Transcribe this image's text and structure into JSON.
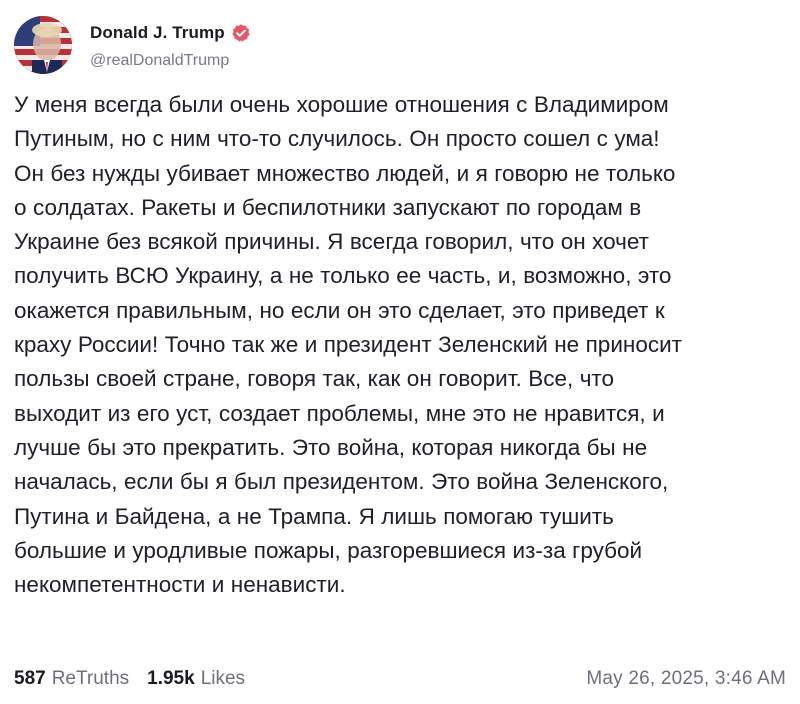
{
  "post": {
    "author": {
      "display_name": "Donald J. Trump",
      "handle": "@realDonaldTrump",
      "verified": true,
      "avatar": "avatar",
      "badge_icon": "verified-badge-icon",
      "badge_color": "#e5556a"
    },
    "body_lines": [
      "У меня всегда были очень хорошие отношения с Владимиром",
      "Путиным, но с ним что-то случилось. Он просто сошел с ума!",
      "Он без нужды убивает множество людей, и я говорю не только",
      "о солдатах. Ракеты и беспилотники запускают по городам в",
      "Украине без всякой причины. Я всегда говорил, что он хочет",
      "получить ВСЮ Украину, а не только ее часть, и, возможно, это",
      "окажется правильным, но если он это сделает, это приведет к",
      "краху России! Точно так же и президент Зеленский не приносит",
      "пользы своей стране, говоря так, как он говорит. Все, что",
      "выходит из его уст, создает проблемы, мне это не нравится, и",
      "лучше бы это прекратить. Это война, которая никогда бы не",
      "началась, если бы я был президентом. Это война Зеленского,",
      "Путина и Байдена, а не Трампа. Я лишь помогаю тушить",
      "большие и уродливые пожары, разгоревшиеся из-за грубой",
      "некомпетентности и ненависти."
    ],
    "stats": {
      "retruths_count": "587",
      "retruths_label": "ReTruths",
      "likes_count": "1.95k",
      "likes_label": "Likes"
    },
    "timestamp": "May 26, 2025, 3:46 AM"
  }
}
